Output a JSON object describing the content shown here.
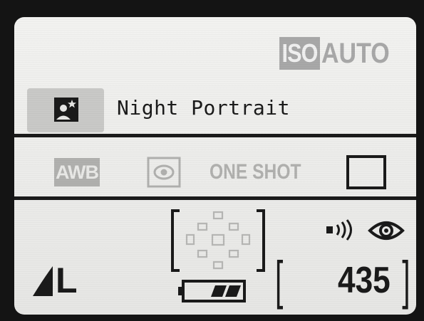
{
  "iso": {
    "badge": "ISO",
    "value": "AUTO"
  },
  "shooting_mode": {
    "label": "Night Portrait",
    "icon": "night-portrait-icon"
  },
  "white_balance": {
    "label": "AWB"
  },
  "metering": {
    "icon": "evaluative-metering-icon"
  },
  "af_operation": {
    "label": "ONE SHOT"
  },
  "drive_mode": {
    "icon": "single-shot-drive-icon"
  },
  "image_quality": {
    "label": "L",
    "icon": "large-quality-icon"
  },
  "af_points": {
    "icon": "af-point-selection-icon",
    "count": 9
  },
  "battery": {
    "icon": "battery-icon"
  },
  "beep": {
    "icon": "beep-icon"
  },
  "eye_detection": {
    "icon": "eye-icon"
  },
  "shots_remaining": {
    "value": "435"
  },
  "colors": {
    "screen_bg": "#eeeeec",
    "ink": "#1a1a1a",
    "dim": "#a8a8a8"
  }
}
